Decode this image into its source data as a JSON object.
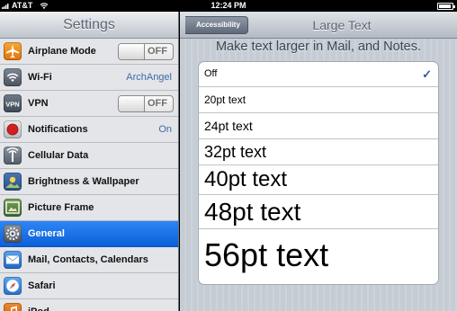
{
  "status_bar": {
    "carrier": "AT&T",
    "time": "12:24 PM"
  },
  "left_pane": {
    "title": "Settings",
    "items": [
      {
        "label": "Airplane Mode",
        "icon": "airplane-icon",
        "control": "toggle",
        "toggle_text": "OFF"
      },
      {
        "label": "Wi-Fi",
        "icon": "wifi-icon",
        "value": "ArchAngel"
      },
      {
        "label": "VPN",
        "icon": "vpn-icon",
        "control": "toggle",
        "toggle_text": "OFF"
      },
      {
        "label": "Notifications",
        "icon": "notifications-icon",
        "value": "On"
      },
      {
        "label": "Cellular Data",
        "icon": "cellular-data-icon"
      },
      {
        "label": "Brightness & Wallpaper",
        "icon": "brightness-wallpaper-icon"
      },
      {
        "label": "Picture Frame",
        "icon": "picture-frame-icon"
      },
      {
        "label": "General",
        "icon": "general-gear-icon",
        "selected": true
      },
      {
        "label": "Mail, Contacts, Calendars",
        "icon": "mail-icon"
      },
      {
        "label": "Safari",
        "icon": "safari-compass-icon"
      },
      {
        "label": "iPod",
        "icon": "ipod-icon"
      }
    ],
    "vpn_icon_text": "VPN"
  },
  "right_pane": {
    "back_button": "Accessibility",
    "title": "Large Text",
    "section_title": "Make text larger in Mail, and Notes.",
    "options": [
      {
        "label": "Off",
        "checked": true
      },
      {
        "label": "20pt text"
      },
      {
        "label": "24pt text"
      },
      {
        "label": "32pt text"
      },
      {
        "label": "40pt text"
      },
      {
        "label": "48pt text"
      },
      {
        "label": "56pt text"
      }
    ],
    "check_glyph": "✓"
  },
  "colors": {
    "selected_row": "#1a6fe6",
    "detail_value": "#3e6aa8",
    "checkmark": "#355b96"
  }
}
